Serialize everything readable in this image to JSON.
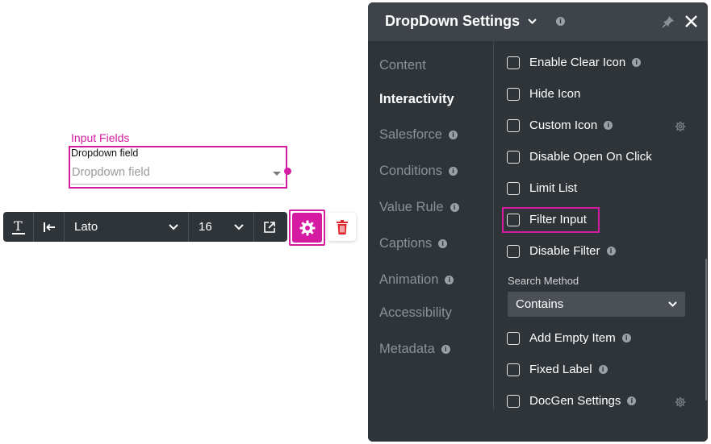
{
  "canvas": {
    "selection_label": "Input Fields",
    "dropdown_label": "Dropdown field",
    "dropdown_placeholder": "Dropdown field"
  },
  "toolbar": {
    "font_name": "Lato",
    "font_size": "16"
  },
  "panel": {
    "title": "DropDown Settings",
    "nav": [
      {
        "label": "Content"
      },
      {
        "label": "Interactivity"
      },
      {
        "label": "Salesforce"
      },
      {
        "label": "Conditions"
      },
      {
        "label": "Value Rule"
      },
      {
        "label": "Captions"
      },
      {
        "label": "Animation"
      },
      {
        "label": "Accessibility"
      },
      {
        "label": "Metadata"
      }
    ],
    "options": [
      {
        "label": "Enable Clear Icon"
      },
      {
        "label": "Hide Icon"
      },
      {
        "label": "Custom Icon"
      },
      {
        "label": "Disable Open On Click"
      },
      {
        "label": "Limit List"
      },
      {
        "label": "Filter Input"
      },
      {
        "label": "Disable Filter"
      },
      {
        "label": "Add Empty Item"
      },
      {
        "label": "Fixed Label"
      },
      {
        "label": "DocGen Settings"
      }
    ],
    "search_method": {
      "label": "Search Method",
      "value": "Contains"
    },
    "info_glyph": "i"
  },
  "colors": {
    "accent": "#d61ba3",
    "panel_bg": "#2f3439",
    "trash": "#e0262b"
  }
}
